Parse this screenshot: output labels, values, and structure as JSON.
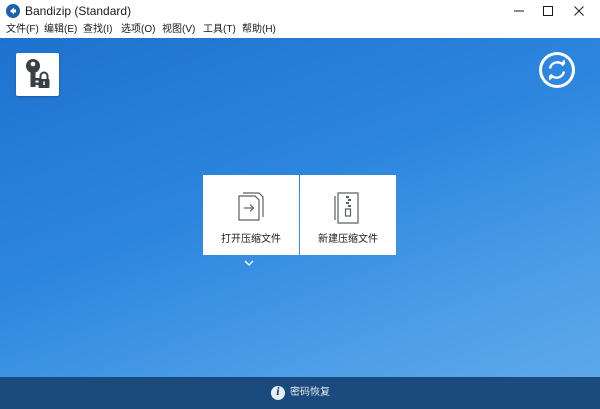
{
  "window": {
    "title": "Bandizip (Standard)",
    "icon": "bandizip-logo-icon"
  },
  "menu": [
    {
      "label": "文件(F)"
    },
    {
      "label": "编辑(E)"
    },
    {
      "label": "查找(I)"
    },
    {
      "label": "选项(O)"
    },
    {
      "label": "视图(V)"
    },
    {
      "label": "工具(T)"
    },
    {
      "label": "帮助(H)"
    }
  ],
  "toolbar": {
    "password_manager_icon": "key-lock-icon",
    "refresh_icon": "refresh-icon"
  },
  "actions": [
    {
      "label": "打开压缩文件",
      "icon": "open-archive-icon"
    },
    {
      "label": "新建压缩文件",
      "icon": "new-archive-icon"
    }
  ],
  "status": {
    "label": "密码恢复",
    "icon": "info-icon"
  },
  "colors": {
    "background_start": "#1f72cf",
    "background_end": "#5da8ea",
    "statusbar": "#1a4a7e",
    "tile": "#ffffff"
  }
}
